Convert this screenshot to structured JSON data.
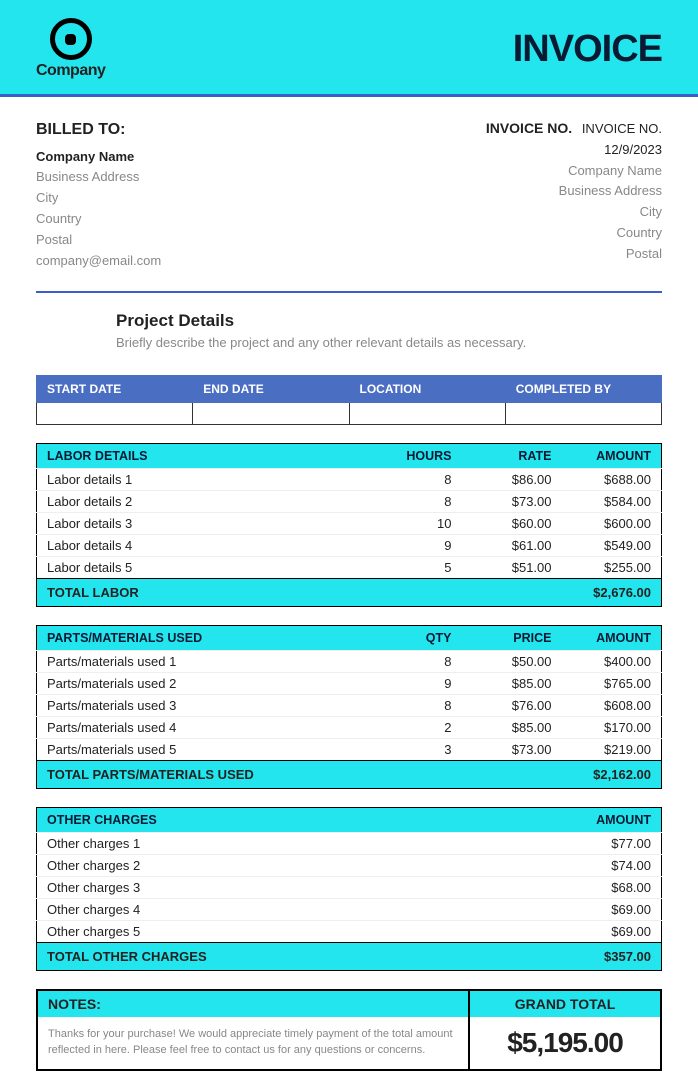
{
  "header": {
    "company_logo_text": "Company",
    "invoice_title": "INVOICE"
  },
  "billed_to": {
    "heading": "BILLED TO:",
    "company": "Company Name",
    "address": "Business Address",
    "city": "City",
    "country": "Country",
    "postal": "Postal",
    "email": "company@email.com"
  },
  "invoice_side": {
    "inv_no_label": "INVOICE NO.",
    "inv_no_value": "INVOICE NO.",
    "date": "12/9/2023",
    "company": "Company Name",
    "address": "Business Address",
    "city": "City",
    "country": "Country",
    "postal": "Postal"
  },
  "project": {
    "heading": "Project Details",
    "desc": "Briefly describe the project and any other relevant details as necessary."
  },
  "info_headers": {
    "start": "START DATE",
    "end": "END DATE",
    "location": "LOCATION",
    "completed": "COMPLETED BY"
  },
  "labor": {
    "headers": {
      "details": "LABOR DETAILS",
      "hours": "HOURS",
      "rate": "RATE",
      "amount": "AMOUNT"
    },
    "rows": [
      {
        "details": "Labor details 1",
        "hours": "8",
        "rate": "$86.00",
        "amount": "$688.00"
      },
      {
        "details": "Labor details 2",
        "hours": "8",
        "rate": "$73.00",
        "amount": "$584.00"
      },
      {
        "details": "Labor details 3",
        "hours": "10",
        "rate": "$60.00",
        "amount": "$600.00"
      },
      {
        "details": "Labor details 4",
        "hours": "9",
        "rate": "$61.00",
        "amount": "$549.00"
      },
      {
        "details": "Labor details 5",
        "hours": "5",
        "rate": "$51.00",
        "amount": "$255.00"
      }
    ],
    "total_label": "TOTAL LABOR",
    "total_value": "$2,676.00"
  },
  "parts": {
    "headers": {
      "details": "PARTS/MATERIALS USED",
      "qty": "QTY",
      "price": "PRICE",
      "amount": "AMOUNT"
    },
    "rows": [
      {
        "details": "Parts/materials used 1",
        "qty": "8",
        "price": "$50.00",
        "amount": "$400.00"
      },
      {
        "details": "Parts/materials used 2",
        "qty": "9",
        "price": "$85.00",
        "amount": "$765.00"
      },
      {
        "details": "Parts/materials used 3",
        "qty": "8",
        "price": "$76.00",
        "amount": "$608.00"
      },
      {
        "details": "Parts/materials used 4",
        "qty": "2",
        "price": "$85.00",
        "amount": "$170.00"
      },
      {
        "details": "Parts/materials used 5",
        "qty": "3",
        "price": "$73.00",
        "amount": "$219.00"
      }
    ],
    "total_label": "TOTAL PARTS/MATERIALS USED",
    "total_value": "$2,162.00"
  },
  "other": {
    "headers": {
      "details": "OTHER CHARGES",
      "amount": "AMOUNT"
    },
    "rows": [
      {
        "details": "Other charges 1",
        "amount": "$77.00"
      },
      {
        "details": "Other charges 2",
        "amount": "$74.00"
      },
      {
        "details": "Other charges 3",
        "amount": "$68.00"
      },
      {
        "details": "Other charges 4",
        "amount": "$69.00"
      },
      {
        "details": "Other charges 5",
        "amount": "$69.00"
      }
    ],
    "total_label": "TOTAL OTHER CHARGES",
    "total_value": "$357.00"
  },
  "notes": {
    "heading": "NOTES:",
    "body": "Thanks for your purchase! We would appreciate timely payment of the total amount reflected in here. Please feel free to contact us for any questions or concerns."
  },
  "grand_total": {
    "heading": "GRAND TOTAL",
    "value": "$5,195.00"
  }
}
